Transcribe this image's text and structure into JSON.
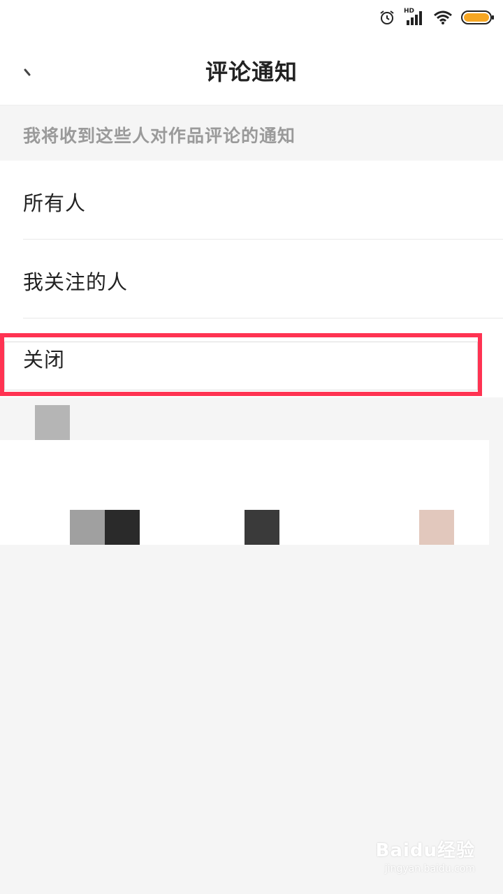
{
  "status_bar": {
    "icons": [
      "alarm-icon",
      "hd-signal-icon",
      "wifi-icon",
      "battery-icon"
    ],
    "hd_label": "HD"
  },
  "header": {
    "title": "评论通知",
    "back_icon": "back-arrow-icon"
  },
  "section": {
    "label": "我将收到这些人对作品评论的通知"
  },
  "options": [
    {
      "label": "所有人"
    },
    {
      "label": "我关注的人"
    },
    {
      "label": "关闭"
    }
  ],
  "colors": {
    "highlight": "#ff3352",
    "background": "#f5f5f5",
    "battery": "#f5a623"
  },
  "watermark": {
    "main": "Baidu经验",
    "sub": "jingyan.baidu.com"
  }
}
